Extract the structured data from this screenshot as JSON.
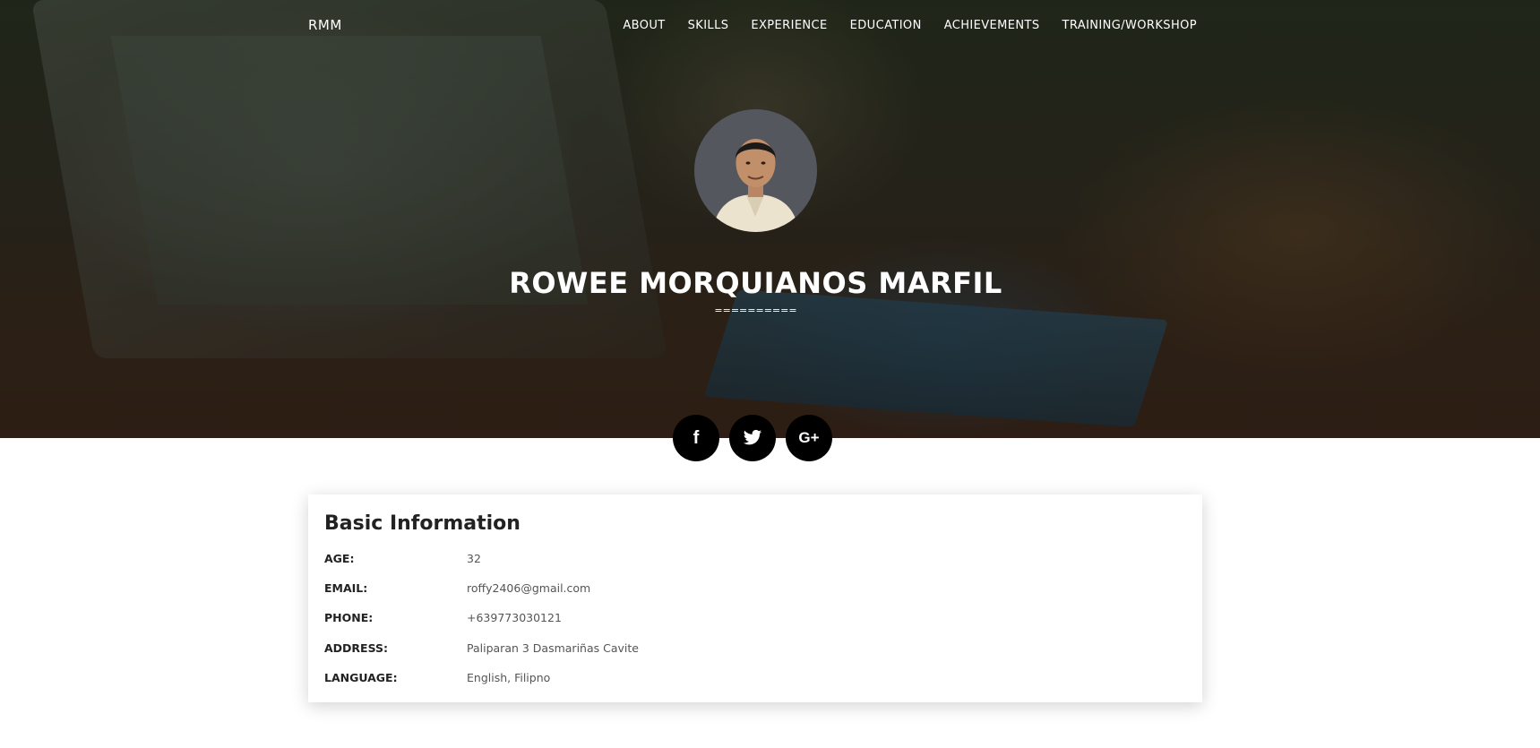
{
  "header": {
    "brand": "RMM",
    "nav": [
      "ABOUT",
      "SKILLS",
      "EXPERIENCE",
      "EDUCATION",
      "ACHIEVEMENTS",
      "TRAINING/WORKSHOP"
    ]
  },
  "hero": {
    "name": "ROWEE MORQUIANOS MARFIL",
    "divider": "=========="
  },
  "social": {
    "facebook": "f",
    "twitter_icon": "twitter-icon",
    "googleplus": "G+"
  },
  "basic_info": {
    "title": "Basic Information",
    "rows": [
      {
        "label": "AGE:",
        "value": "32"
      },
      {
        "label": "EMAIL:",
        "value": "roffy2406@gmail.com"
      },
      {
        "label": "PHONE:",
        "value": "+639773030121"
      },
      {
        "label": "ADDRESS:",
        "value": "Paliparan 3 Dasmariñas Cavite"
      },
      {
        "label": "LANGUAGE:",
        "value": "English, Filipno"
      }
    ]
  },
  "colors": {
    "social_bg": "#000000",
    "card_bg": "#ffffff",
    "text_dark": "#222222",
    "text_muted": "#555555"
  }
}
